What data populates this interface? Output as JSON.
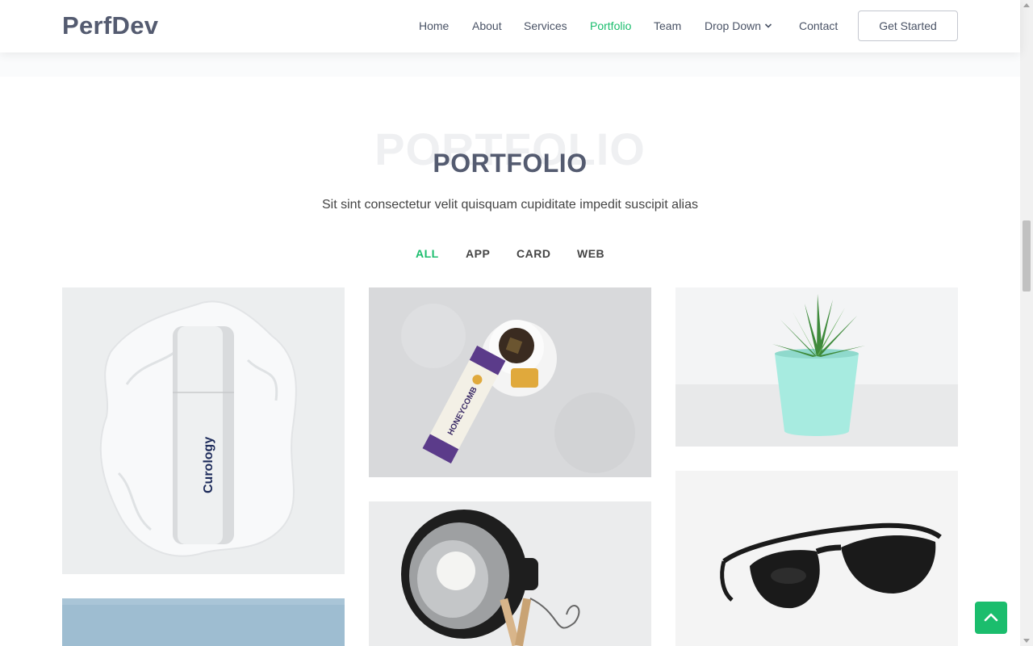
{
  "header": {
    "logo": "PerfDev",
    "nav": [
      {
        "label": "Home"
      },
      {
        "label": "About"
      },
      {
        "label": "Services"
      },
      {
        "label": "Portfolio",
        "active": true
      },
      {
        "label": "Team"
      },
      {
        "label": "Drop Down",
        "dropdown": true
      },
      {
        "label": "Contact"
      }
    ],
    "cta_label": "Get Started"
  },
  "portfolio": {
    "bg_title": "PORTFOLIO",
    "title": "PORTFOLIO",
    "subtitle": "Sit sint consectetur velit quisquam cupiditate impedit suscipit alias",
    "filters": [
      {
        "label": "ALL",
        "active": true
      },
      {
        "label": "APP"
      },
      {
        "label": "CARD"
      },
      {
        "label": "WEB"
      }
    ],
    "items": [
      {
        "subject": "white-bottle",
        "brand_text": "Curology"
      },
      {
        "subject": "tea-and-honeycomb",
        "brand_text": "HONEYCOMB"
      },
      {
        "subject": "succulent-plant"
      },
      {
        "subject": "desk-lamp"
      },
      {
        "subject": "sunglasses"
      },
      {
        "subject": "blue-background"
      }
    ]
  },
  "colors": {
    "accent": "#1bbd6d",
    "heading": "#545b70",
    "text": "#444444"
  },
  "icons": {
    "dropdown": "chevron-down-icon",
    "back_to_top": "chevron-up-icon"
  }
}
